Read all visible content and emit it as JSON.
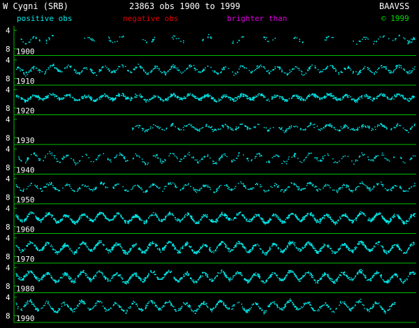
{
  "header": {
    "star": "W Cygni (SRB)",
    "summary": "23863 obs 1900 to 1999",
    "org": "BAAVSS"
  },
  "legend": {
    "positive": "positive obs",
    "negative": "negative obs",
    "brighter": "brighter than",
    "copyright": "© 1999"
  },
  "colors": {
    "background": "#000000",
    "axis": "#00c000",
    "positive": "#00e8e8",
    "negative": "#e00000",
    "brighter": "#e000e0",
    "text": "#ffffff",
    "copyright": "#00e000"
  },
  "chart_data": {
    "type": "scatter",
    "title": "W Cygni (SRB)",
    "subtitle": "23863 obs 1900 to 1999",
    "yticks": [
      "4",
      "8"
    ],
    "ylim": [
      3.5,
      9
    ],
    "y_inverted": true,
    "grid": false,
    "panels": [
      {
        "label": "1900",
        "start_year": 1900,
        "end_year": 1909,
        "coverage": [
          [
            0.13,
            0.18
          ],
          [
            0.22,
            0.27
          ],
          [
            0.32,
            0.39
          ],
          [
            0.42,
            0.46
          ],
          [
            0.5,
            0.52
          ],
          [
            0.58,
            0.6
          ],
          [
            0.76,
            0.77
          ],
          [
            0.82,
            0.85
          ],
          [
            0.91,
            0.93
          ],
          [
            1.7,
            2.0
          ],
          [
            2.3,
            2.7
          ],
          [
            3.1,
            3.5
          ],
          [
            3.9,
            4.2
          ],
          [
            4.6,
            4.9
          ],
          [
            5.4,
            5.7
          ],
          [
            6.2,
            6.5
          ],
          [
            6.9,
            7.2
          ],
          [
            7.7,
            8.0
          ],
          [
            8.4,
            10.0
          ]
        ],
        "mean": 5.9,
        "amp": 0.6,
        "density": 0.5
      },
      {
        "label": "1910",
        "start_year": 1910,
        "end_year": 1919,
        "coverage": [
          [
            0,
            10
          ]
        ],
        "mean": 6.0,
        "amp": 0.7,
        "density": 0.9
      },
      {
        "label": "1920",
        "start_year": 1920,
        "end_year": 1929,
        "coverage": [
          [
            0,
            10
          ]
        ],
        "mean": 5.6,
        "amp": 0.5,
        "density": 1.6
      },
      {
        "label": "1930",
        "start_year": 1930,
        "end_year": 1939,
        "coverage": [
          [
            2.9,
            10
          ]
        ],
        "mean": 5.7,
        "amp": 0.5,
        "density": 0.8
      },
      {
        "label": "1940",
        "start_year": 1940,
        "end_year": 1949,
        "coverage": [
          [
            0,
            10
          ]
        ],
        "mean": 5.9,
        "amp": 0.8,
        "density": 0.6
      },
      {
        "label": "1950",
        "start_year": 1950,
        "end_year": 1959,
        "coverage": [
          [
            0,
            10
          ]
        ],
        "mean": 5.8,
        "amp": 0.7,
        "density": 0.8
      },
      {
        "label": "1960",
        "start_year": 1960,
        "end_year": 1969,
        "coverage": [
          [
            0,
            10
          ]
        ],
        "mean": 6.0,
        "amp": 0.8,
        "density": 2.0
      },
      {
        "label": "1970",
        "start_year": 1970,
        "end_year": 1979,
        "coverage": [
          [
            0,
            10
          ]
        ],
        "mean": 6.0,
        "amp": 0.9,
        "density": 1.8
      },
      {
        "label": "1980",
        "start_year": 1980,
        "end_year": 1989,
        "coverage": [
          [
            0,
            10
          ]
        ],
        "mean": 5.9,
        "amp": 0.9,
        "density": 1.7
      },
      {
        "label": "1990",
        "start_year": 1990,
        "end_year": 1999,
        "coverage": [
          [
            0,
            9.5
          ]
        ],
        "mean": 5.9,
        "amp": 0.9,
        "density": 1.2
      }
    ]
  }
}
